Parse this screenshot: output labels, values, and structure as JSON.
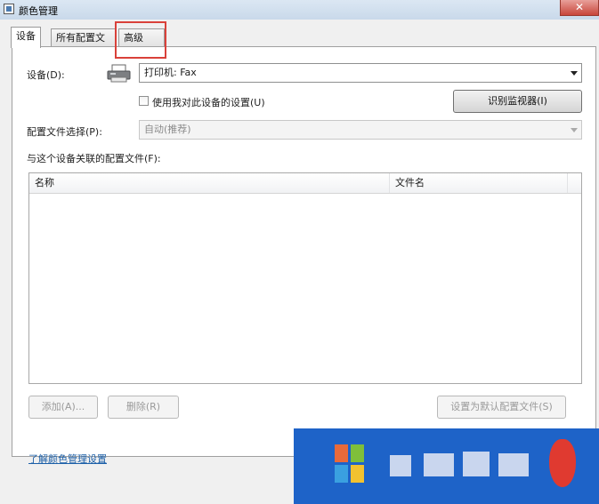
{
  "window": {
    "title": "颜色管理",
    "close_glyph": "✕",
    "icon": "app-window-icon"
  },
  "tabs": [
    {
      "label": "设备",
      "active": true
    },
    {
      "label": "所有配置文件",
      "active": false
    },
    {
      "label": "高级",
      "active": false,
      "highlighted": true
    }
  ],
  "device": {
    "label": "设备(D):",
    "value": "打印机: Fax",
    "icon": "printer-icon",
    "checkbox_label": "使用我对此设备的设置(U)",
    "checkbox_checked": false,
    "identify_button": "识别监视器(I)"
  },
  "profile_selection": {
    "label": "配置文件选择(P):",
    "value": "自动(推荐)"
  },
  "associated": {
    "label": "与这个设备关联的配置文件(F):",
    "columns": [
      "名称",
      "文件名"
    ],
    "rows": []
  },
  "buttons": {
    "add": "添加(A)...",
    "remove": "删除(R)",
    "set_default": "设置为默认配置文件(S)"
  },
  "link": "了解颜色管理设置",
  "colors": {
    "highlight": "#d9413a",
    "overlay": "#1e63c8",
    "link": "#1b5fa8"
  }
}
